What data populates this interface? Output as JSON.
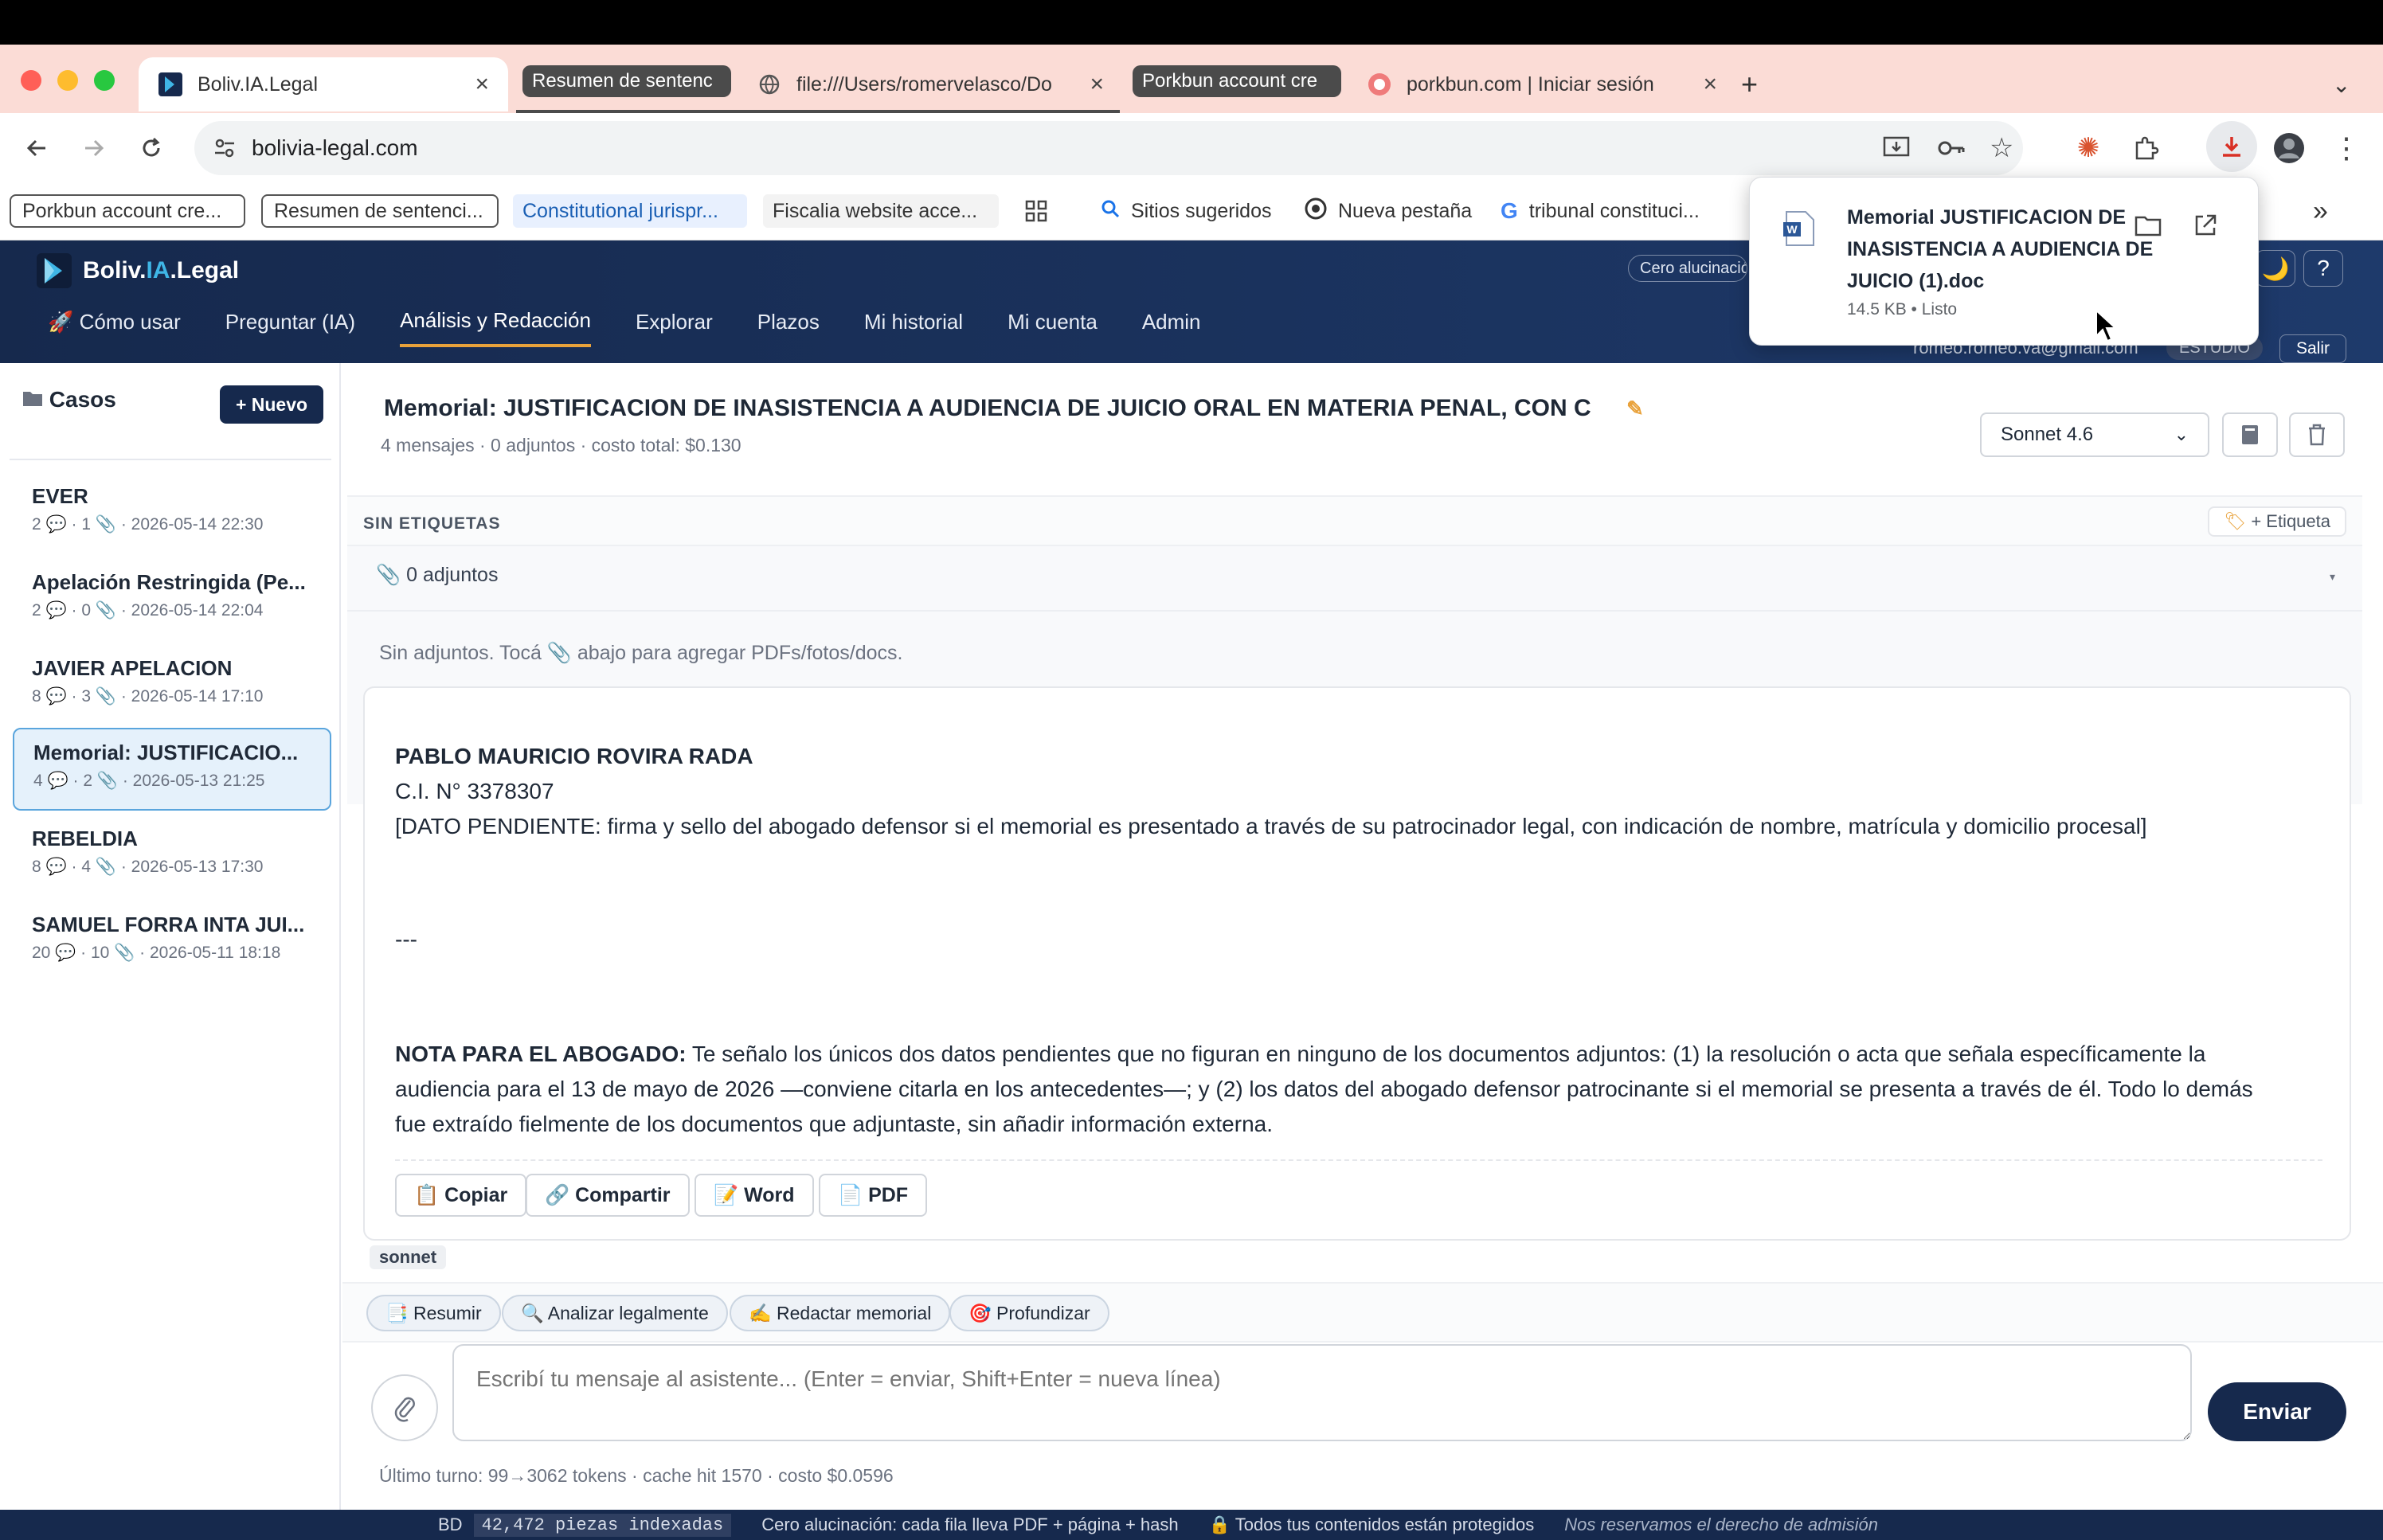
{
  "browser": {
    "tabs": [
      {
        "label": "Boliv.IA.Legal",
        "active": true
      },
      {
        "label": "Resumen de sentenc",
        "group": true
      },
      {
        "label": "file:///Users/romervelasco/Do"
      },
      {
        "label": "Porkbun account cre",
        "group": true
      },
      {
        "label": "porkbun.com | Iniciar sesión"
      }
    ],
    "url": "bolivia-legal.com",
    "bookmarks": [
      "Porkbun account cre...",
      "Resumen de sentenci...",
      "Constitutional jurispr...",
      "Fiscalia website acce...",
      "Sitios sugeridos",
      "Nueva pestaña",
      "tribunal constituci..."
    ],
    "more_bookmarks": "»"
  },
  "download": {
    "filename": "Memorial JUSTIFICACION DE INASISTENCIA A AUDIENCIA DE JUICIO (1).doc",
    "meta": "14.5 KB • Listo"
  },
  "app": {
    "brand_prefix": "Boliv.",
    "brand_mid": "IA",
    "brand_suffix": ".Legal",
    "nav": [
      "🚀 Cómo usar",
      "Preguntar (IA)",
      "Análisis y Redacción",
      "Explorar",
      "Plazos",
      "Mi historial",
      "Mi cuenta",
      "Admin"
    ],
    "active_nav_index": 2,
    "cero_chip": "Cero alucinación",
    "email": "romeo.romeo.va@gmail.com",
    "plan": "ESTUDIO",
    "logout": "Salir",
    "moon": "🌙",
    "help": "?"
  },
  "sidebar": {
    "title": "Casos",
    "new_button": "+ Nuevo",
    "cases": [
      {
        "title": "EVER",
        "meta": "2 💬 · 1 📎 · 2026-05-14 22:30"
      },
      {
        "title": "Apelación Restringida (Pe...",
        "meta": "2 💬 · 0 📎 · 2026-05-14 22:04"
      },
      {
        "title": "JAVIER APELACION",
        "meta": "8 💬 · 3 📎 · 2026-05-14 17:10"
      },
      {
        "title": "Memorial: JUSTIFICACIO...",
        "meta": "4 💬 · 2 📎 · 2026-05-13 21:25",
        "active": true
      },
      {
        "title": "REBELDIA",
        "meta": "8 💬 · 4 📎 · 2026-05-13 17:30"
      },
      {
        "title": "SAMUEL FORRA INTA JUI...",
        "meta": "20 💬 · 10 📎 · 2026-05-11 18:18"
      }
    ]
  },
  "document": {
    "title": "Memorial: JUSTIFICACION DE INASISTENCIA A AUDIENCIA DE JUICIO ORAL EN MATERIA PENAL, CON C",
    "meta": "4 mensajes · 0 adjuntos · costo total: $0.130",
    "model": "Sonnet 4.6",
    "tags_label": "SIN ETIQUETAS",
    "add_tag": "+ Etiqueta",
    "attachments_label": "0 adjuntos",
    "attachments_empty_a": "Sin adjuntos. Tocá",
    "attachments_empty_b": "abajo para agregar PDFs/fotos/docs."
  },
  "message": {
    "signer_name": "PABLO MAURICIO ROVIRA RADA",
    "ci": "C.I. N° 3378307",
    "pending": "[DATO PENDIENTE: firma y sello del abogado defensor si el memorial es presentado a través de su patrocinador legal, con indicación de nombre, matrícula y domicilio procesal]",
    "hr": "---",
    "note_label": "NOTA PARA EL ABOGADO:",
    "note_line1": "Te señalo los únicos dos datos pendientes que no figuran en ninguno de los documentos adjuntos: (1) la resolución o acta que señala específicamente la",
    "note_line2": "audiencia para el 13 de mayo de 2026 —conviene citarla en los antecedentes—; y (2) los datos del abogado defensor patrocinante si el memorial se presenta a través de él. Todo lo demás",
    "note_line3": "fue extraído fielmente de los documentos que adjuntaste, sin añadir información externa.",
    "actions": [
      "📋 Copiar",
      "🔗 Compartir",
      "📝 Word",
      "📄 PDF"
    ],
    "model_tag": "sonnet"
  },
  "quick_actions": [
    "📑 Resumir",
    "🔍 Analizar legalmente",
    "✍ Redactar memorial",
    "🎯 Profundizar"
  ],
  "composer": {
    "placeholder": "Escribí tu mensaje al asistente... (Enter = enviar, Shift+Enter = nueva línea)",
    "send": "Enviar",
    "last_turn": "Último turno: 99→3062 tokens · cache hit 1570 · costo $0.0596"
  },
  "footer": {
    "bd": "BD",
    "count": "42,472 piezas indexadas",
    "cero": "Cero alucinación: cada fila lleva PDF + página + hash",
    "secure": "🔒 Todos tus contenidos están protegidos",
    "rights": "Nos reservamos el derecho de admisión"
  },
  "colors": {
    "navy": "#16294d",
    "accent": "#e9a23b",
    "tabstrip": "#fbdcd6"
  }
}
